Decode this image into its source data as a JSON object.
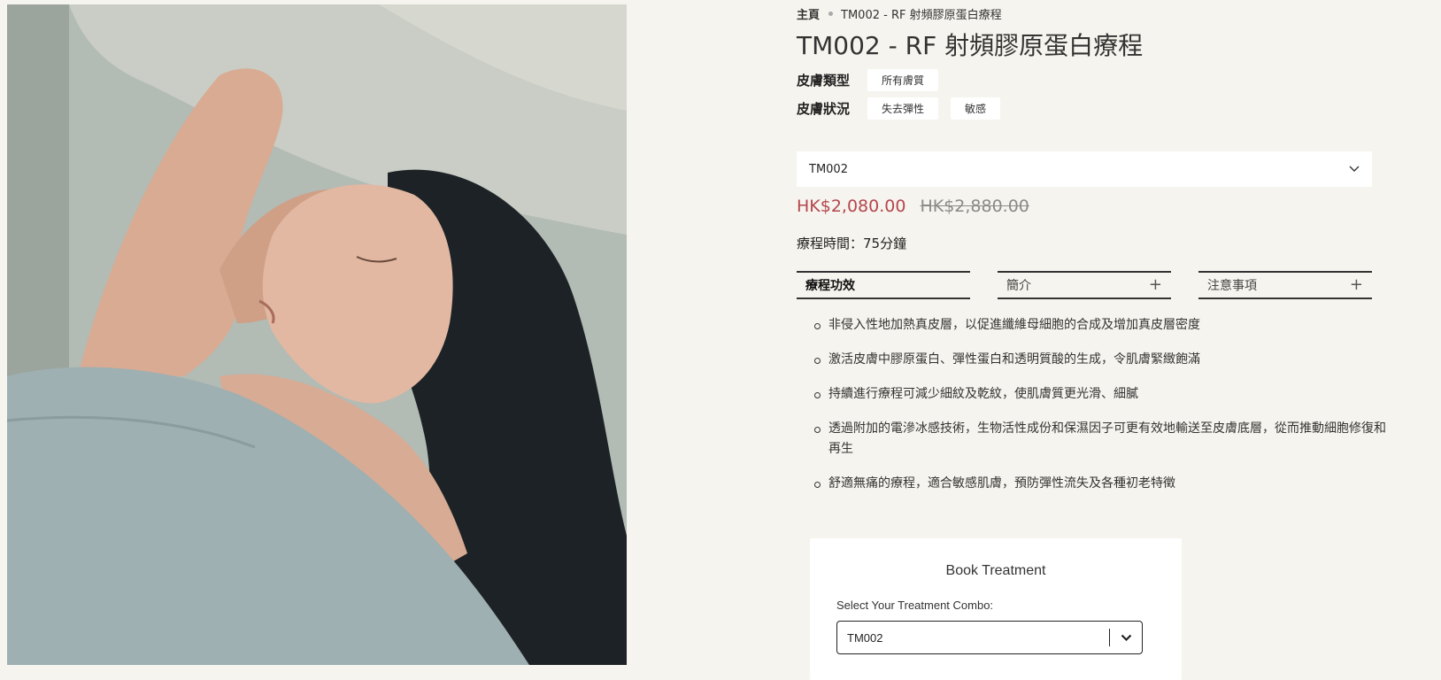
{
  "photo": {
    "icon": "woman-resting-photo"
  },
  "breadcrumb": {
    "home": "主頁",
    "current": "TM002 - RF 射頻膠原蛋白療程"
  },
  "product": {
    "title": "TM002 - RF 射頻膠原蛋白療程",
    "skin_type": {
      "label": "皮膚類型",
      "tags": [
        "所有膚質"
      ]
    },
    "skin_condition": {
      "label": "皮膚狀況",
      "tags": [
        "失去彈性",
        "敏感"
      ]
    },
    "variant": {
      "selected": "TM002",
      "icon": "chevron-down-icon"
    },
    "price_sale": "HK$2,080.00",
    "price_original": "HK$2,880.00",
    "duration": "療程時間：75分鐘",
    "colors": {
      "sale": "#b3474e",
      "background": "#f6f4ee"
    }
  },
  "tabs": [
    {
      "label": "療程功效",
      "active": true
    },
    {
      "label": "簡介",
      "icon": "plus-icon"
    },
    {
      "label": "注意事項",
      "icon": "plus-icon"
    }
  ],
  "benefits": [
    "非侵入性地加熱真皮層，以促進纖維母細胞的合成及增加真皮層密度",
    "激活皮膚中膠原蛋白、彈性蛋白和透明質酸的生成，令肌膚緊緻飽滿",
    "持續進行療程可減少細紋及乾紋，使肌膚質更光滑、細膩",
    "透過附加的電滲冰感技術，生物活性成份和保濕因子可更有效地輸送至皮膚底層，從而推動細胞修復和再生",
    "舒適無痛的療程，適合敏感肌膚，預防彈性流失及各種初老特徵"
  ],
  "booking": {
    "title": "Book Treatment",
    "combo_label": "Select Your Treatment Combo:",
    "combo_value": "TM002"
  }
}
